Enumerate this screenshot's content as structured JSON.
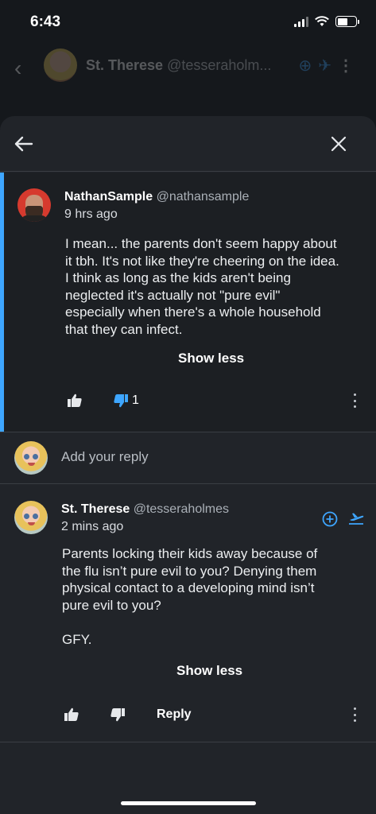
{
  "status_bar": {
    "time": "6:43",
    "battery_level": 0.55
  },
  "background_header": {
    "name": "St. Therese",
    "handle": "@tesseraholm..."
  },
  "comments": [
    {
      "author": "NathanSample",
      "handle": "@nathansample",
      "time": "9 hrs ago",
      "lines": [
        "I mean... the parents don't seem happy about",
        "it tbh. It's not like they're cheering on the idea.",
        "I think as long as the kids aren't being",
        "neglected it's actually not \"pure evil\"",
        "especially when there's a whole household",
        "that they can infect."
      ],
      "show_less": "Show less",
      "dislike_count": "1"
    },
    {
      "author": "St. Therese",
      "handle": "@tesseraholmes",
      "time": "2 mins ago",
      "lines": [
        "Parents locking their kids away because of",
        "the flu isn’t pure evil to you? Denying them",
        "physical contact to a developing mind isn’t",
        "pure evil to you?",
        "",
        "GFY."
      ],
      "show_less": "Show less",
      "reply_label": "Reply"
    }
  ],
  "reply_bar": {
    "placeholder": "Add your reply"
  },
  "colors": {
    "accent": "#3ea6ff",
    "sheet": "#212429",
    "highlight": "#1c1f23"
  },
  "icons": [
    "back-arrow-icon",
    "close-icon",
    "thumb-up-icon",
    "thumb-down-icon",
    "more-vert-icon",
    "add-circle-icon",
    "takeoff-icon"
  ]
}
